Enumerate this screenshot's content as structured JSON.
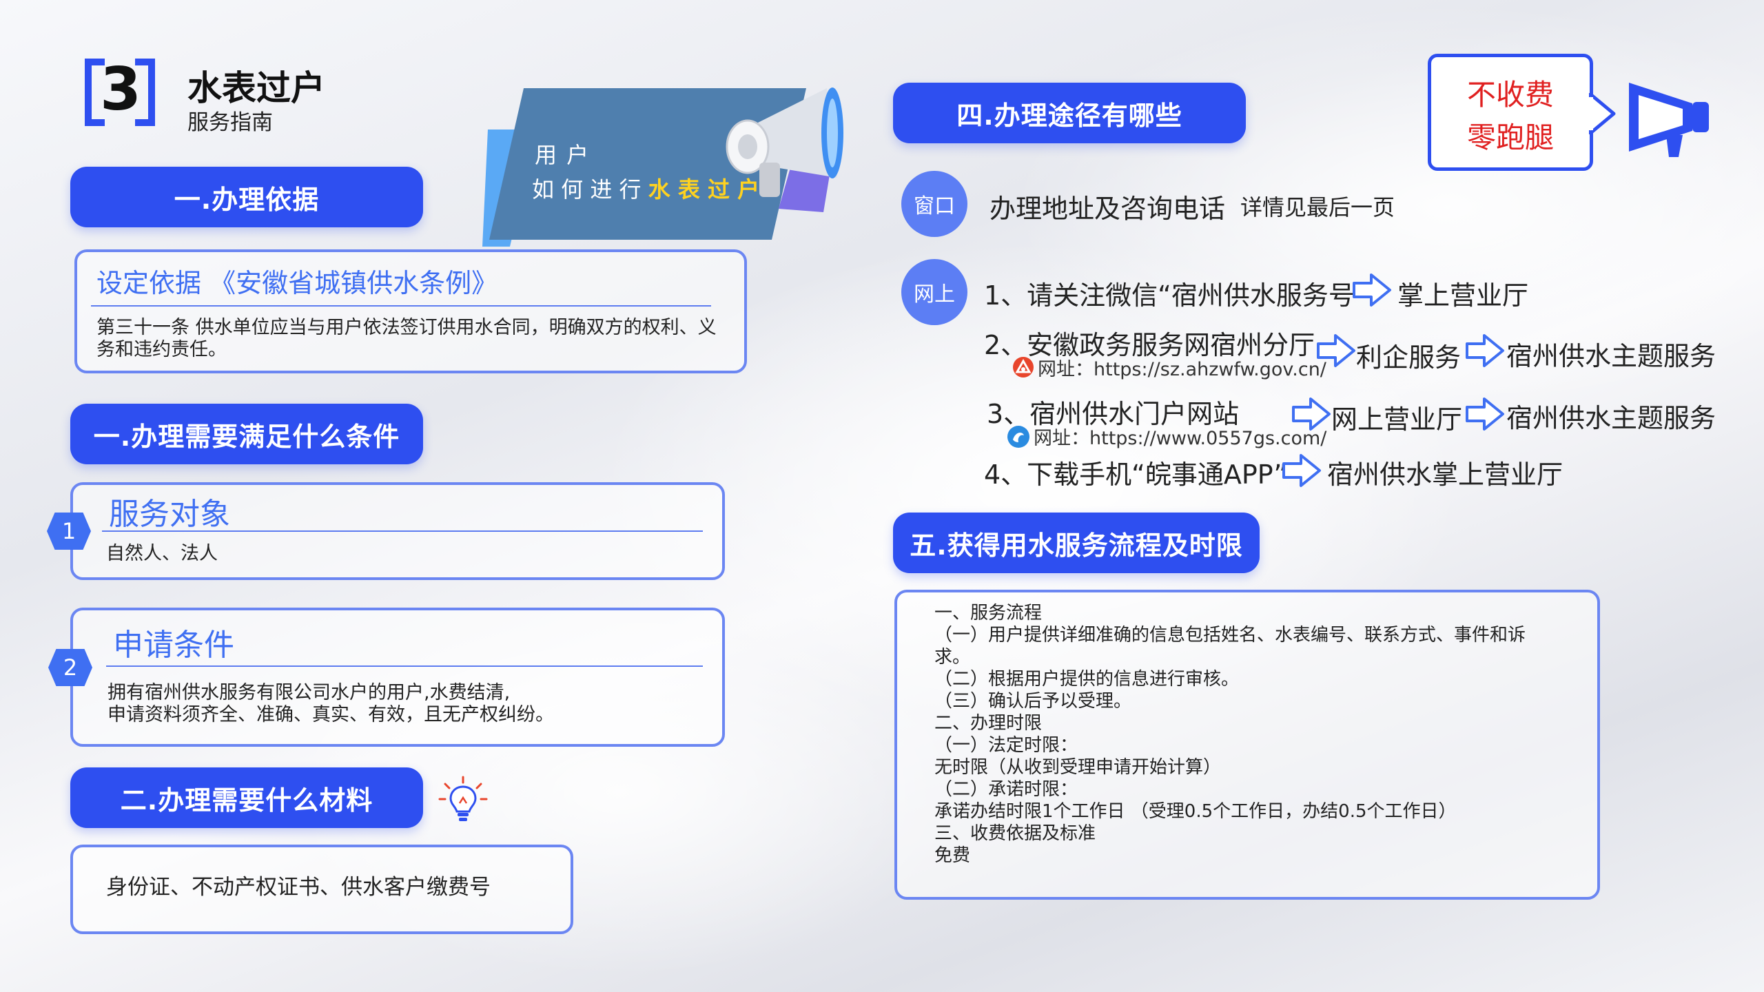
{
  "header": {
    "step_number": "3",
    "title": "水表过户",
    "subtitle": "服务指南"
  },
  "banner": {
    "line1": "用 户",
    "line2_prefix": "如 何 进 行 ",
    "line2_highlight": "水 表 过 户"
  },
  "badge": {
    "line1": "不收费",
    "line2": "零跑腿"
  },
  "section1": {
    "pill": "一.办理依据",
    "card_title": "设定依据 《安徽省城镇供水条例》",
    "card_text": "第三十一条 供水单位应当与用户依法签订供用水合同，明确双方的权利、义务和违约责任。"
  },
  "section2": {
    "pill": "一.办理需要满足什么条件",
    "item1": {
      "num": "1",
      "title": "服务对象",
      "text": "自然人、法人"
    },
    "item2": {
      "num": "2",
      "title": "申请条件",
      "text_line1": "拥有宿州供水服务有限公司水户的用户,水费结清,",
      "text_line2": "申请资料须齐全、准确、真实、有效，且无产权纠纷。"
    }
  },
  "section3": {
    "pill": "二.办理需要什么材料",
    "card_text": "身份证、不动产权证书、供水客户缴费号"
  },
  "section4": {
    "pill": "四.办理途径有哪些",
    "window": {
      "circle": "窗口",
      "text": "办理地址及咨询电话",
      "note": "详情见最后一页"
    },
    "online": {
      "circle": "网上",
      "item1": {
        "text": "1、请关注微信“宿州供水服务号”",
        "target": "掌上营业厅"
      },
      "item2": {
        "text": "2、安徽政务服务网宿州分厅",
        "url": "网址：https://sz.ahzwfw.gov.cn/",
        "step1": "利企服务",
        "step2": "宿州供水主题服务"
      },
      "item3": {
        "text": "3、宿州供水门户网站",
        "url": "网址：https://www.0557gs.com/",
        "step1": "网上营业厅",
        "step2": "宿州供水主题服务"
      },
      "item4": {
        "text": "4、下载手机“皖事通APP”",
        "target": "宿州供水掌上营业厅"
      }
    }
  },
  "section5": {
    "pill": "五.获得用水服务流程及时限",
    "lines": [
      "一、服务流程",
      "（一）用户提供详细准确的信息包括姓名、水表编号、联系方式、事件和诉",
      "求。",
      "（二）根据用户提供的信息进行审核。",
      "（三）确认后予以受理。",
      "二、办理时限",
      "（一）法定时限：",
      "无时限（从收到受理申请开始计算）",
      "（二）承诺时限：",
      "承诺办结时限1个工作日 （受理0.5个工作日，办结0.5个工作日）",
      "三、收费依据及标准",
      "免费"
    ]
  },
  "colors": {
    "primary": "#2e4ff0",
    "accent": "#3f6ff2",
    "badge_red": "#e02020",
    "highlight_yellow": "#ffd21f"
  }
}
